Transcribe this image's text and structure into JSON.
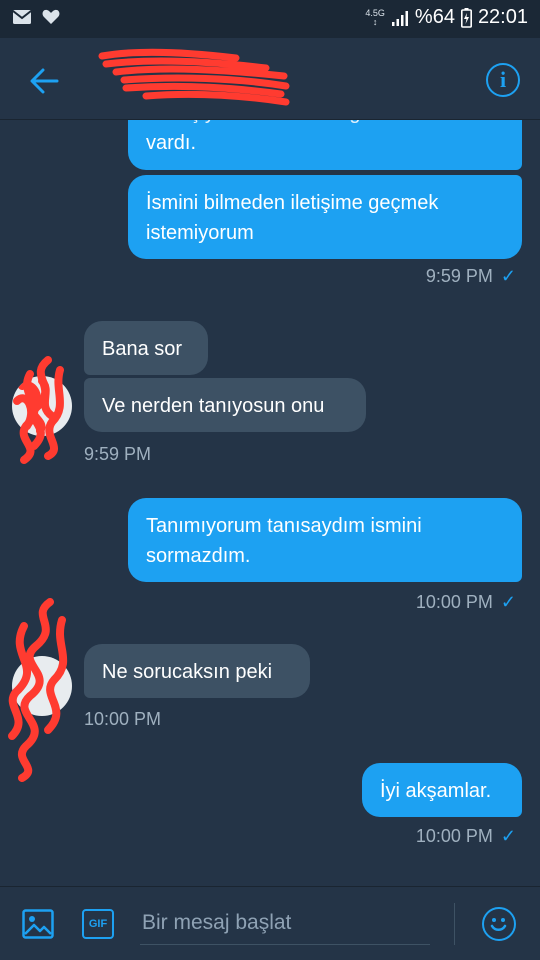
{
  "status_bar": {
    "network": "4.5G",
    "battery": "%64",
    "time": "22:01"
  },
  "header": {
    "back_icon": "arrow-left-icon",
    "info_icon": "info-icon"
  },
  "messages": [
    {
      "type": "sent",
      "text": "vardı.",
      "partial_top_text": "Bu kişiye sormak istediğim bir soru"
    },
    {
      "type": "sent",
      "text": "İsmini bilmeden iletişime geçmek istemiyorum"
    },
    {
      "type": "sent_timestamp",
      "text": "9:59 PM"
    },
    {
      "type": "received",
      "text": "Bana sor"
    },
    {
      "type": "received",
      "text": "Ve nerden tanıyosun onu"
    },
    {
      "type": "received_timestamp",
      "text": "9:59 PM"
    },
    {
      "type": "sent",
      "text": "Tanımıyorum tanısaydım ismini sormazdım."
    },
    {
      "type": "sent_timestamp",
      "text": "10:00 PM"
    },
    {
      "type": "received",
      "text": "Ne sorucaksın peki"
    },
    {
      "type": "received_timestamp",
      "text": "10:00 PM"
    },
    {
      "type": "sent",
      "text": "İyi akşamlar."
    },
    {
      "type": "sent_timestamp",
      "text": "10:00 PM"
    }
  ],
  "composer": {
    "placeholder": "Bir mesaj başlat",
    "gif_label": "GIF"
  },
  "colors": {
    "background": "#243447",
    "accent": "#1da1f2",
    "received_bubble": "#3d5164",
    "redaction": "#ff3b30"
  }
}
